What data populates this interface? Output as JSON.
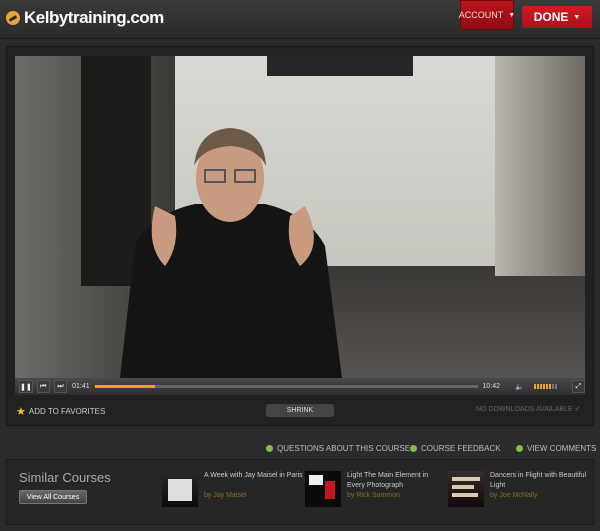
{
  "header": {
    "logo_text": "Kelbytraining.com",
    "account_label": "ACCOUNT",
    "done_label": "DONE"
  },
  "player": {
    "time_current": "01:41",
    "time_total": "10:42",
    "progress_fraction": 0.157,
    "volume_level": 0.75
  },
  "actions": {
    "favorites_label": "ADD TO FAVORITES",
    "shrink_label": "SHRINK",
    "no_downloads_label": "NO DOWNLOADS AVAILABLE"
  },
  "links": {
    "questions_label": "QUESTIONS ABOUT THIS COURSE",
    "feedback_label": "COURSE FEEDBACK",
    "comments_label": "VIEW COMMENTS"
  },
  "similar": {
    "title": "Similar Courses",
    "view_all_label": "View All Courses",
    "courses": [
      {
        "title": "A Week with Jay Maisel in Paris",
        "author": "by Jay Maisel"
      },
      {
        "title": "Light The Main Element in Every Photograph",
        "author": "by Rick Sammon"
      },
      {
        "title": "Dancers in Flight with Beautiful Light",
        "author": "by Joe McNally"
      }
    ]
  },
  "colors": {
    "accent": "#f0a31e",
    "brand_red": "#c0161e",
    "link_dot": "#8cb84b"
  }
}
